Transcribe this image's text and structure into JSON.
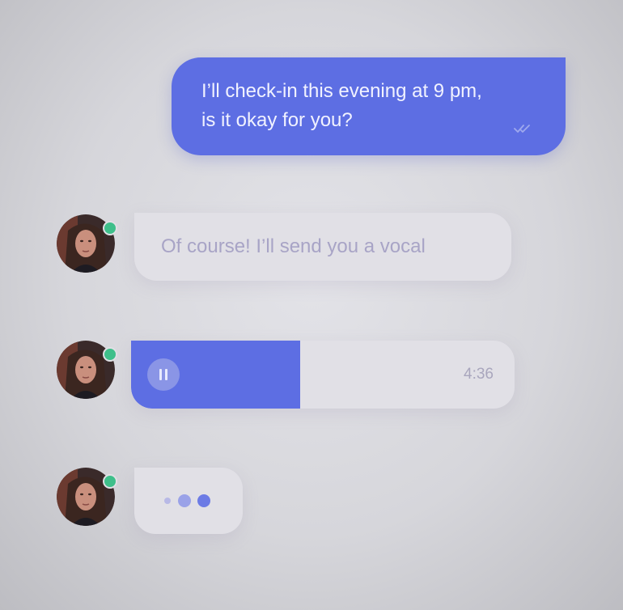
{
  "conversation": {
    "outgoing_message": {
      "line1": "I’ll check-in this evening at 9 pm,",
      "line2": "is it okay for you?",
      "status_icon": "double-check-icon"
    },
    "incoming_message": {
      "text": "Of course! I’ll send you a vocal"
    },
    "voice_message": {
      "duration": "4:36",
      "playback_progress": 0.44,
      "control_icon": "pause-icon"
    },
    "typing_indicator": {
      "icon": "typing-dots-icon"
    },
    "contact": {
      "avatar_icon": "contact-avatar",
      "status": "online"
    }
  },
  "colors": {
    "accent": "#5d6ee3",
    "online": "#3ebf8a",
    "bubble_in": "#e1e0e6",
    "muted_text": "#a8a4c6"
  }
}
